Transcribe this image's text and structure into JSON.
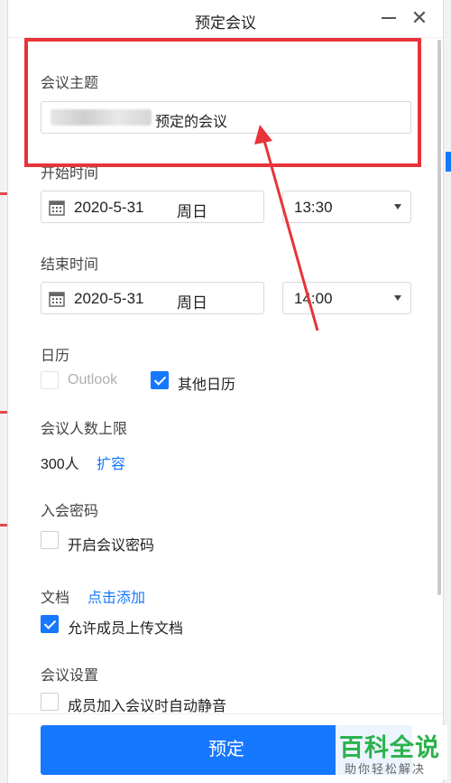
{
  "dialog": {
    "title": "预定会议",
    "minimize_icon": "minimize-icon",
    "close_label": "✕"
  },
  "topic": {
    "label": "会议主题",
    "value": "预定的会议"
  },
  "start": {
    "label": "开始时间",
    "date": "2020-5-31",
    "weekday": "周日",
    "time": "13:30"
  },
  "end": {
    "label": "结束时间",
    "date": "2020-5-31",
    "weekday": "周日",
    "time": "14:00"
  },
  "calendar": {
    "label": "日历",
    "options": [
      {
        "label": "Outlook",
        "checked": false,
        "disabled": true
      },
      {
        "label": "其他日历",
        "checked": true,
        "disabled": false
      }
    ]
  },
  "capacity": {
    "label": "会议人数上限",
    "value": "300人",
    "expand_link": "扩容"
  },
  "password": {
    "label": "入会密码",
    "option": "开启会议密码",
    "checked": false
  },
  "docs": {
    "label": "文档",
    "add_link": "点击添加",
    "option": "允许成员上传文档",
    "checked": true
  },
  "settings": {
    "label": "会议设置",
    "option": "成员加入会议时自动静音",
    "checked": false
  },
  "submit_label": "预定",
  "watermark": {
    "title": "百科全说",
    "subtitle": "助你轻松解决"
  },
  "colors": {
    "accent": "#1677ff",
    "annotation": "#e8333a",
    "watermark": "#2bb24c"
  }
}
